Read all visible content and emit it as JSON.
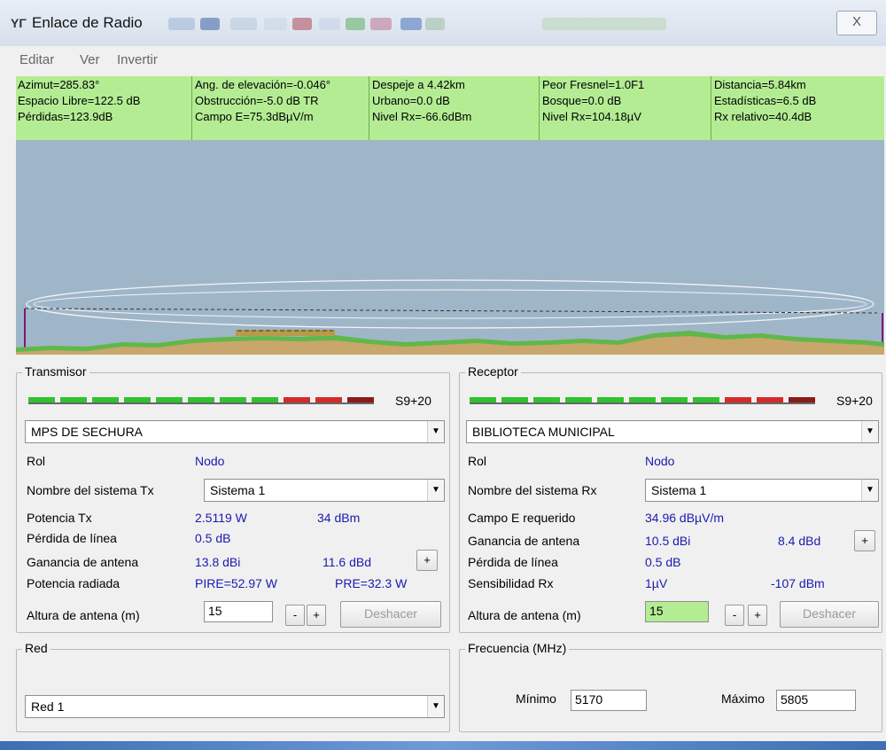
{
  "window": {
    "title": "Enlace de Radio",
    "close_glyph": "X"
  },
  "menu": [
    "Editar",
    "Ver",
    "Invertir"
  ],
  "info": {
    "azimut": "Azimut=285.83°",
    "espacio_libre": "Espacio Libre=122.5 dB",
    "perdidas": "Pérdidas=123.9dB",
    "ang_elevacion": "Ang. de elevación=-0.046°",
    "obstruccion": "Obstrucción=-5.0 dB TR",
    "campo_e": "Campo E=75.3dBµV/m",
    "despeje": "Despeje a 4.42km",
    "urbano": "Urbano=0.0 dB",
    "nivel_rx_dbm": "Nivel Rx=-66.6dBm",
    "peor_fresnel": "Peor Fresnel=1.0F1",
    "bosque": "Bosque=0.0 dB",
    "nivel_rx_uv": "Nivel Rx=104.18µV",
    "distancia": "Distancia=5.84km",
    "estadisticas": "Estadísticas=6.5 dB",
    "rx_relativo": "Rx relativo=40.4dB"
  },
  "transmisor": {
    "group_label": "Transmisor",
    "signal": "S9+20",
    "station": "MPS DE SECHURA",
    "rol_label": "Rol",
    "rol_value": "Nodo",
    "sistema_label": "Nombre del sistema Tx",
    "sistema_value": "Sistema  1",
    "potencia_label": "Potencia Tx",
    "potencia_w": "2.5119 W",
    "potencia_dbm": "34 dBm",
    "perdida_label": "Pérdida de línea",
    "perdida_value": "0.5 dB",
    "ganancia_label": "Ganancia de antena",
    "ganancia_dbi": "13.8 dBi",
    "ganancia_dbd": "11.6 dBd",
    "radiada_label": "Potencia radiada",
    "pire": "PIRE=52.97 W",
    "pre": "PRE=32.3 W",
    "altura_label": "Altura de antena (m)",
    "altura_value": "15",
    "minus": "-",
    "plus": "+",
    "deshacer": "Deshacer"
  },
  "receptor": {
    "group_label": "Receptor",
    "signal": "S9+20",
    "station": "BIBLIOTECA MUNICIPAL",
    "rol_label": "Rol",
    "rol_value": "Nodo",
    "sistema_label": "Nombre del sistema Rx",
    "sistema_value": "Sistema  1",
    "campo_label": "Campo E requerido",
    "campo_value": "34.96 dBµV/m",
    "ganancia_label": "Ganancia de antena",
    "ganancia_dbi": "10.5 dBi",
    "ganancia_dbd": "8.4 dBd",
    "perdida_label": "Pérdida de línea",
    "perdida_value": "0.5 dB",
    "sens_label": "Sensibilidad Rx",
    "sens_uv": "1µV",
    "sens_dbm": "-107 dBm",
    "altura_label": "Altura de antena (m)",
    "altura_value": "15",
    "minus": "-",
    "plus": "+",
    "deshacer": "Deshacer"
  },
  "red": {
    "group_label": "Red",
    "value": "Red 1"
  },
  "frecuencia": {
    "group_label": "Frecuencia (MHz)",
    "min_label": "Mínimo",
    "min_value": "5170",
    "max_label": "Máximo",
    "max_value": "5805"
  },
  "colors": {
    "info_bg": "#b4ec94",
    "profile_sky": "#9fb6c8",
    "terrain": "#5fb84a",
    "meter_green": "#2fc32f",
    "meter_red": "#d42a2a",
    "label_blue": "#1a1ab0"
  }
}
